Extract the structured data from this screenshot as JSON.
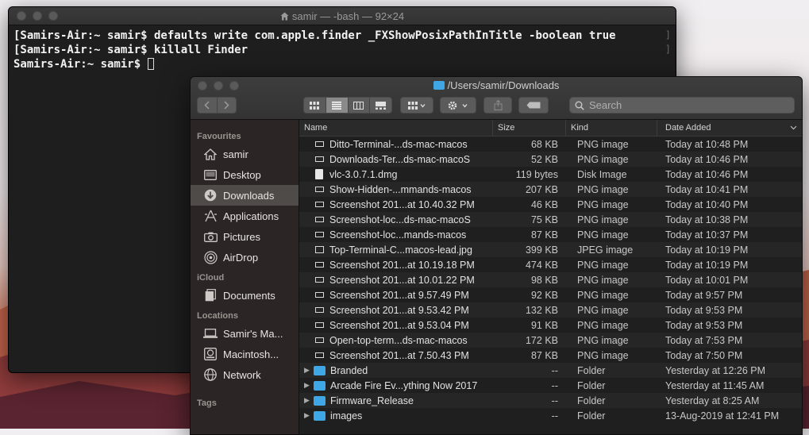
{
  "terminal": {
    "title": "samir — -bash — 92×24",
    "lines": [
      "[Samirs-Air:~ samir$ defaults write com.apple.finder _FXShowPosixPathInTitle -boolean true",
      "[Samirs-Air:~ samir$ killall Finder",
      "Samirs-Air:~ samir$ "
    ]
  },
  "finder": {
    "title": "/Users/samir/Downloads",
    "search_placeholder": "Search",
    "sidebar": {
      "favourites_heading": "Favourites",
      "favourites": [
        {
          "label": "samir",
          "icon": "home-icon"
        },
        {
          "label": "Desktop",
          "icon": "desktop-icon"
        },
        {
          "label": "Downloads",
          "icon": "downloads-icon",
          "selected": true
        },
        {
          "label": "Applications",
          "icon": "applications-icon"
        },
        {
          "label": "Pictures",
          "icon": "camera-icon"
        },
        {
          "label": "AirDrop",
          "icon": "airdrop-icon"
        }
      ],
      "icloud_heading": "iCloud",
      "icloud": [
        {
          "label": "Documents",
          "icon": "documents-icon"
        }
      ],
      "locations_heading": "Locations",
      "locations": [
        {
          "label": "Samir's Ma...",
          "icon": "laptop-icon"
        },
        {
          "label": "Macintosh...",
          "icon": "disk-icon"
        },
        {
          "label": "Network",
          "icon": "globe-icon"
        }
      ],
      "tags_heading": "Tags"
    },
    "columns": {
      "name": "Name",
      "size": "Size",
      "kind": "Kind",
      "date": "Date Added"
    },
    "files": [
      {
        "name": "Ditto-Terminal-...ds-mac-macos",
        "size": "68 KB",
        "kind": "PNG image",
        "date": "Today at 10:48 PM",
        "type": "png"
      },
      {
        "name": "Downloads-Ter...ds-mac-macoS",
        "size": "52 KB",
        "kind": "PNG image",
        "date": "Today at 10:46 PM",
        "type": "png"
      },
      {
        "name": "vlc-3.0.7.1.dmg",
        "size": "119 bytes",
        "kind": "Disk Image",
        "date": "Today at 10:46 PM",
        "type": "doc"
      },
      {
        "name": "Show-Hidden-...mmands-macos",
        "size": "207 KB",
        "kind": "PNG image",
        "date": "Today at 10:41 PM",
        "type": "png"
      },
      {
        "name": "Screenshot 201...at 10.40.32 PM",
        "size": "46 KB",
        "kind": "PNG image",
        "date": "Today at 10:40 PM",
        "type": "png"
      },
      {
        "name": "Screenshot-loc...ds-mac-macoS",
        "size": "75 KB",
        "kind": "PNG image",
        "date": "Today at 10:38 PM",
        "type": "png"
      },
      {
        "name": "Screenshot-loc...mands-macos",
        "size": "87 KB",
        "kind": "PNG image",
        "date": "Today at 10:37 PM",
        "type": "png"
      },
      {
        "name": "Top-Terminal-C...macos-lead.jpg",
        "size": "399 KB",
        "kind": "JPEG image",
        "date": "Today at 10:19 PM",
        "type": "jpg"
      },
      {
        "name": "Screenshot 201...at 10.19.18 PM",
        "size": "474 KB",
        "kind": "PNG image",
        "date": "Today at 10:19 PM",
        "type": "png"
      },
      {
        "name": "Screenshot 201...at 10.01.22 PM",
        "size": "98 KB",
        "kind": "PNG image",
        "date": "Today at 10:01 PM",
        "type": "png"
      },
      {
        "name": "Screenshot 201...at 9.57.49 PM",
        "size": "92 KB",
        "kind": "PNG image",
        "date": "Today at 9:57 PM",
        "type": "png"
      },
      {
        "name": "Screenshot 201...at 9.53.42 PM",
        "size": "132 KB",
        "kind": "PNG image",
        "date": "Today at 9:53 PM",
        "type": "png"
      },
      {
        "name": "Screenshot 201...at 9.53.04 PM",
        "size": "91 KB",
        "kind": "PNG image",
        "date": "Today at 9:53 PM",
        "type": "png"
      },
      {
        "name": "Open-top-term...ds-mac-macos",
        "size": "172 KB",
        "kind": "PNG image",
        "date": "Today at 7:53 PM",
        "type": "png"
      },
      {
        "name": "Screenshot 201...at 7.50.43 PM",
        "size": "87 KB",
        "kind": "PNG image",
        "date": "Today at 7:50 PM",
        "type": "png"
      },
      {
        "name": "Branded",
        "size": "--",
        "kind": "Folder",
        "date": "Yesterday at 12:26 PM",
        "type": "folder"
      },
      {
        "name": "Arcade Fire Ev...ything Now 2017",
        "size": "--",
        "kind": "Folder",
        "date": "Yesterday at 11:45 AM",
        "type": "folder"
      },
      {
        "name": "Firmware_Release",
        "size": "--",
        "kind": "Folder",
        "date": "Yesterday at 8:25 AM",
        "type": "folder"
      },
      {
        "name": "images",
        "size": "--",
        "kind": "Folder",
        "date": "13-Aug-2019 at 12:41 PM",
        "type": "folder"
      }
    ]
  },
  "colors": {
    "folder": "#3fa7e6",
    "selected_sidebar": "#4f4b49",
    "terminal_bg": "#1e1e1e"
  }
}
